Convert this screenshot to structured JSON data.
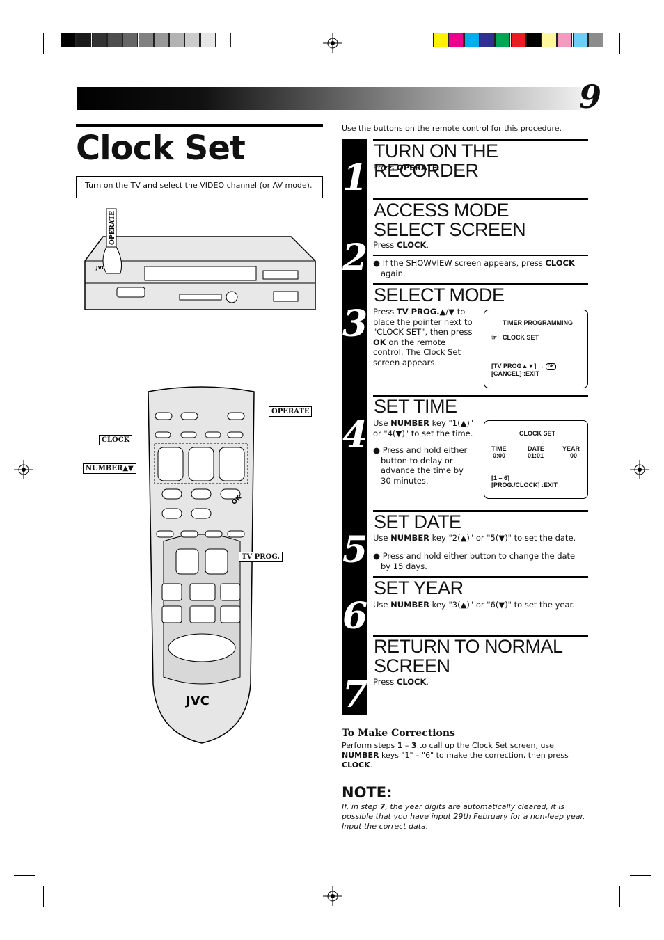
{
  "colors": {
    "gray_swatches": [
      "#000000",
      "#1a1a1a",
      "#333333",
      "#4d4d4d",
      "#666666",
      "#808080",
      "#999999",
      "#b3b3b3",
      "#cccccc",
      "#e6e6e6",
      "#ffffff"
    ],
    "color_swatches": [
      "#fff200",
      "#ec008c",
      "#00aeef",
      "#2e3192",
      "#00a651",
      "#ed1c24",
      "#000000",
      "#fff799",
      "#f49ac1",
      "#6dcff6",
      "#8c8c8c"
    ]
  },
  "page_number": "9",
  "title": "Clock Set",
  "intro_box": "Turn on the TV and select the VIDEO channel (or AV mode).",
  "intro_right": "Use the buttons on the remote control for this procedure.",
  "illustration": {
    "vcr_operate": "OPERATE",
    "vcr_brand": "JVC",
    "remote_brand": "JVC",
    "labels": {
      "operate": "OPERATE",
      "clock": "CLOCK",
      "number": "NUMBER▲▼",
      "tv_prog": "TV PROG.",
      "ok": "OK"
    }
  },
  "steps": [
    {
      "num": "1",
      "title": "TURN ON THE RECORDER",
      "text": [
        {
          "t": "Press "
        },
        {
          "t": "OPERATE",
          "b": 1
        },
        {
          "t": "."
        }
      ]
    },
    {
      "num": "2",
      "title": "ACCESS MODE SELECT SCREEN",
      "text": [
        {
          "t": "Press "
        },
        {
          "t": "CLOCK",
          "b": 1
        },
        {
          "t": "."
        }
      ],
      "bullet": [
        {
          "t": "● If the SHOWVIEW screen appears, press "
        },
        {
          "t": "CLOCK",
          "b": 1
        },
        {
          "t": " again."
        }
      ]
    },
    {
      "num": "3",
      "title": "SELECT MODE",
      "text": [
        {
          "t": "Press "
        },
        {
          "t": "TV PROG.▲",
          "b": 1
        },
        {
          "t": "/"
        },
        {
          "t": "▼",
          "b": 1
        },
        {
          "t": " to place the pointer next to \"CLOCK SET\", then press "
        },
        {
          "t": "OK",
          "b": 1
        },
        {
          "t": " on the remote control. The Clock Set screen appears."
        }
      ]
    },
    {
      "num": "4",
      "title": "SET TIME",
      "text": [
        {
          "t": "Use "
        },
        {
          "t": "NUMBER",
          "b": 1
        },
        {
          "t": " key \"1(▲)\" or \"4(▼)\" to set the time."
        }
      ],
      "bullet": [
        {
          "t": "● Press and hold either button to delay or advance the time by 30 minutes."
        }
      ]
    },
    {
      "num": "5",
      "title": "SET DATE",
      "text": [
        {
          "t": "Use "
        },
        {
          "t": "NUMBER",
          "b": 1
        },
        {
          "t": " key \"2(▲)\" or \"5(▼)\" to set the date."
        }
      ],
      "bullet": [
        {
          "t": "● Press and hold either button to change the date by 15 days."
        }
      ]
    },
    {
      "num": "6",
      "title": "SET YEAR",
      "text": [
        {
          "t": "Use "
        },
        {
          "t": "NUMBER",
          "b": 1
        },
        {
          "t": " key \"3(▲)\" or \"6(▼)\" to set the year."
        }
      ]
    },
    {
      "num": "7",
      "title": "RETURN TO NORMAL SCREEN",
      "text": [
        {
          "t": "Press "
        },
        {
          "t": "CLOCK",
          "b": 1
        },
        {
          "t": "."
        }
      ]
    }
  ],
  "screen1": {
    "title": "TIMER PROGRAMMING",
    "item": "CLOCK SET",
    "nav": "[TV PROG▲▼] →",
    "ok": "OK",
    "exit": "[CANCEL] :EXIT"
  },
  "screen2": {
    "title": "CLOCK SET",
    "time_label": "TIME",
    "time": "0:00",
    "date_label": "DATE",
    "date": "01:01",
    "year_label": "YEAR",
    "year": "00",
    "keys": "[1 – 6]",
    "exit": "[PROG./CLOCK] :EXIT"
  },
  "corrections": {
    "heading": "To Make Corrections",
    "text": [
      {
        "t": "Perform steps "
      },
      {
        "t": "1",
        "b": 1
      },
      {
        "t": " – "
      },
      {
        "t": "3",
        "b": 1
      },
      {
        "t": " to call up the Clock Set screen, use "
      },
      {
        "t": "NUMBER",
        "b": 1
      },
      {
        "t": " keys \"1\" – \"6\" to make the correction, then press "
      },
      {
        "t": "CLOCK",
        "b": 1
      },
      {
        "t": "."
      }
    ]
  },
  "note": {
    "heading": "NOTE:",
    "text": [
      {
        "t": "If, in step "
      },
      {
        "t": "7",
        "b": 1
      },
      {
        "t": ", the year digits are automatically cleared, it is possible that you have input 29th February for a non-leap year. Input the correct data."
      }
    ]
  }
}
